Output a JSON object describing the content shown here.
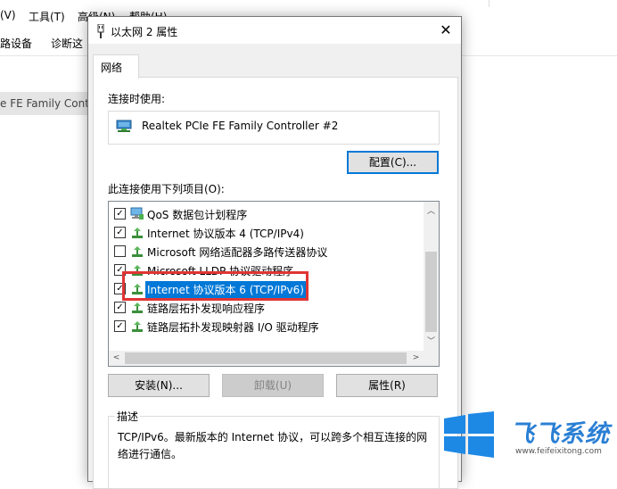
{
  "background": {
    "menu": [
      "(V)",
      "工具(T)",
      "高级(N)",
      "帮助(H)"
    ],
    "toolbar": [
      "路设备",
      "诊断这"
    ],
    "list_row": "e FE Family Contro"
  },
  "dialog": {
    "title": "以太网 2 属性",
    "close": "✕",
    "tab": "网络",
    "connect_using_label": "连接时使用:",
    "adapter_name": "Realtek PCIe FE Family Controller #2",
    "configure_button": "配置(C)...",
    "items_label": "此连接使用下列项目(O):",
    "items": [
      {
        "label": "QoS 数据包计划程序",
        "checked": true,
        "icon": "qos-icon"
      },
      {
        "label": "Internet 协议版本 4 (TCP/IPv4)",
        "checked": true,
        "icon": "protocol-icon"
      },
      {
        "label": "Microsoft 网络适配器多路传送器协议",
        "checked": false,
        "icon": "protocol-icon"
      },
      {
        "label": "Microsoft LLDP 协议驱动程序",
        "checked": true,
        "icon": "protocol-icon"
      },
      {
        "label": "Internet 协议版本 6 (TCP/IPv6)",
        "checked": true,
        "icon": "protocol-icon",
        "selected": true
      },
      {
        "label": "链路层拓扑发现响应程序",
        "checked": true,
        "icon": "protocol-icon"
      },
      {
        "label": "链路层拓扑发现映射器 I/O 驱动程序",
        "checked": true,
        "icon": "protocol-icon"
      }
    ],
    "install_button": "安装(N)...",
    "uninstall_button": "卸载(U)",
    "properties_button": "属性(R)",
    "description_title": "描述",
    "description_text": "TCP/IPv6。最新版本的 Internet 协议，可以跨多个相互连接的网络进行通信。"
  },
  "watermark": {
    "brand": "飞飞系统",
    "url": "www.feifeixitong.com"
  },
  "colors": {
    "selection": "#0078d7",
    "highlight_box": "#e03535",
    "watermark_blue": "#2a7fd4"
  }
}
